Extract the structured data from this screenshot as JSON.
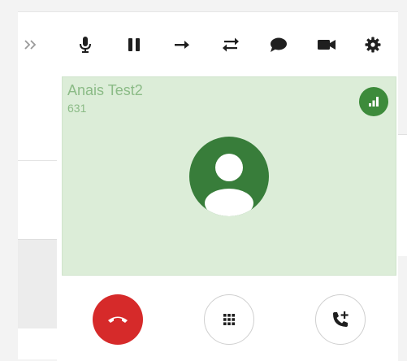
{
  "toolbar": {
    "items": [
      {
        "name": "more",
        "icon": "double-chevron-right-icon"
      },
      {
        "name": "mute",
        "icon": "microphone-icon"
      },
      {
        "name": "hold",
        "icon": "pause-icon"
      },
      {
        "name": "forward",
        "icon": "arrow-right-icon"
      },
      {
        "name": "transfer",
        "icon": "swap-arrows-icon"
      },
      {
        "name": "chat",
        "icon": "chat-bubble-icon"
      },
      {
        "name": "video",
        "icon": "video-camera-icon"
      },
      {
        "name": "settings",
        "icon": "gear-icon"
      }
    ]
  },
  "call": {
    "caller_name": "Anais Test2",
    "caller_number": "631",
    "signal_icon": "signal-bars-icon",
    "avatar_icon": "person-avatar-icon"
  },
  "controls": {
    "hangup_icon": "phone-hangup-icon",
    "dialpad_icon": "dialpad-icon",
    "add_call_icon": "phone-add-icon"
  },
  "colors": {
    "call_bg": "#dcedd8",
    "avatar": "#387d3a",
    "signal": "#3d8b3b",
    "hangup": "#d62a2a",
    "caller_text": "#8bbb86",
    "icon": "#1f1f1f"
  }
}
